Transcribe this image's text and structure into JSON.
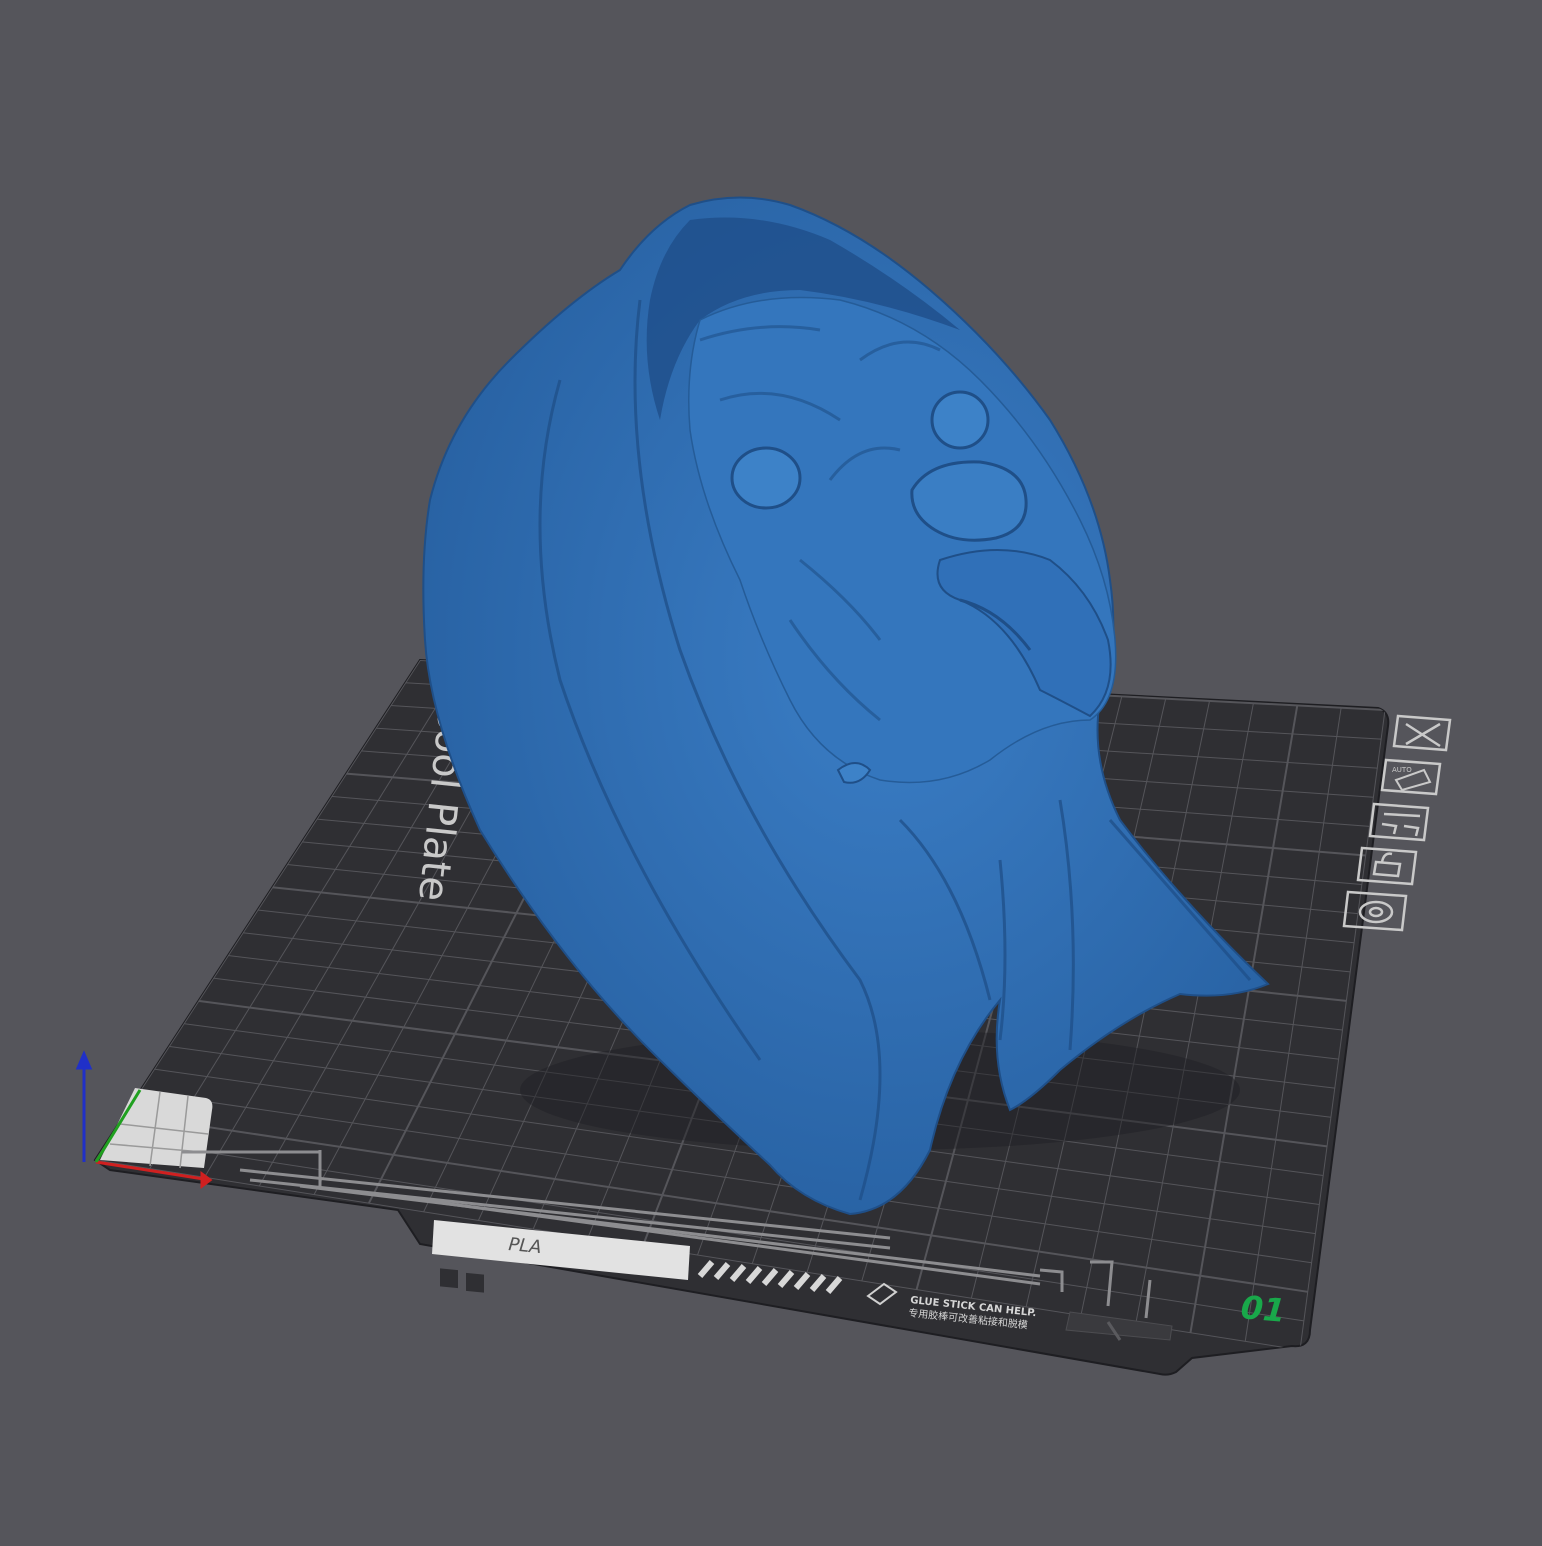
{
  "viewport": {
    "background": "#55555b",
    "plate_color": "#2f2f33",
    "grid_color": "#55555a",
    "model_color": "#2f6eb5"
  },
  "plate": {
    "type_label": "Cool Plate",
    "material_label": "PLA",
    "notice_en": "GLUE STICK CAN HELP.",
    "notice_cn": "专用胶棒可改善粘接和脱模",
    "plate_number": "01",
    "plate_number_color": "#19a84a"
  },
  "plate_toolbar": {
    "items": [
      {
        "icon": "close-icon"
      },
      {
        "icon": "auto-orient-icon",
        "text": "AUTO"
      },
      {
        "icon": "arrange-icon"
      },
      {
        "icon": "lock-icon"
      },
      {
        "icon": "settings-icon"
      }
    ]
  },
  "axes": {
    "x_color": "#d02020",
    "y_color": "#20a020",
    "z_color": "#2030c8"
  },
  "model": {
    "name_icon": "hooded-dog-bust-model"
  }
}
